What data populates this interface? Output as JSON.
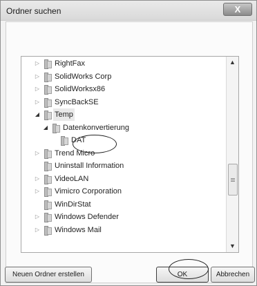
{
  "dialog": {
    "title": "Ordner suchen",
    "close_label": "X"
  },
  "tree": {
    "items": [
      {
        "label": "RightFax",
        "expander": "▷",
        "indent": 0
      },
      {
        "label": "SolidWorks Corp",
        "expander": "▷",
        "indent": 0
      },
      {
        "label": "SolidWorksx86",
        "expander": "▷",
        "indent": 0
      },
      {
        "label": "SyncBackSE",
        "expander": "▷",
        "indent": 0
      },
      {
        "label": "Temp",
        "expander": "◢",
        "indent": 0,
        "selected": true
      },
      {
        "label": "Datenkonvertierung",
        "expander": "◢",
        "indent": 1
      },
      {
        "label": "DAT",
        "expander": "",
        "indent": 2,
        "highlighted": true
      },
      {
        "label": "Trend Micro",
        "expander": "▷",
        "indent": 0
      },
      {
        "label": "Uninstall Information",
        "expander": "",
        "indent": 0
      },
      {
        "label": "VideoLAN",
        "expander": "▷",
        "indent": 0
      },
      {
        "label": "Vimicro Corporation",
        "expander": "▷",
        "indent": 0
      },
      {
        "label": "WinDirStat",
        "expander": "",
        "indent": 0
      },
      {
        "label": "Windows Defender",
        "expander": "▷",
        "indent": 0
      },
      {
        "label": "Windows Mail",
        "expander": "▷",
        "indent": 0
      }
    ],
    "scroll_up": "▲",
    "scroll_down": "▼"
  },
  "buttons": {
    "new_folder": "Neuen Ordner erstellen",
    "ok": "OK",
    "cancel": "Abbrechen"
  }
}
